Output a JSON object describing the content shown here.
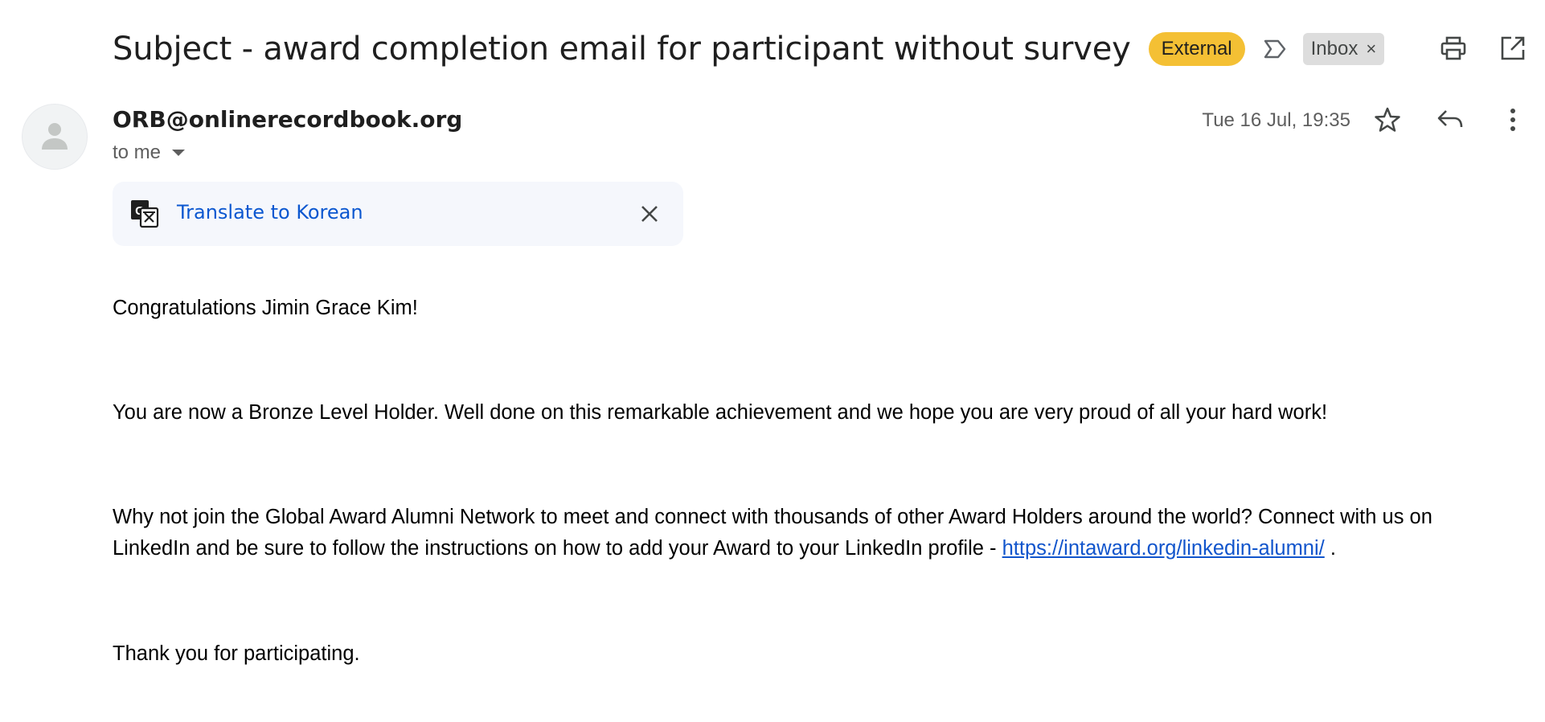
{
  "header": {
    "subject": "Subject - award completion email for participant without survey",
    "external_label": "External",
    "inbox_label": "Inbox",
    "inbox_remove": "×"
  },
  "message": {
    "sender": "ORB@onlinerecordbook.org",
    "recipient": "to me",
    "date": "Tue 16 Jul, 19:35"
  },
  "translate": {
    "link_label": "Translate to Korean"
  },
  "body": {
    "greeting": "Congratulations Jimin Grace Kim!",
    "paragraph1": "You are now a Bronze Level Holder. Well done on this remarkable achievement and we hope you are very proud of all your hard work!",
    "paragraph2_text": "Why not join the Global Award Alumni Network to meet and connect with thousands of other Award Holders around the world? Connect with us on LinkedIn and be sure to follow the instructions on how to add your Award to your LinkedIn profile - ",
    "paragraph2_link": "https://intaward.org/linkedin-alumni/",
    "paragraph2_end": " .",
    "closing": "Thank you for participating."
  },
  "colors": {
    "external_badge": "#f4c034",
    "inbox_badge": "#dddddd",
    "link_blue": "#0b57d0",
    "body_link": "#1155cc",
    "translate_bg": "#f5f7fc"
  },
  "icons": {
    "importance": "importance-marker-icon",
    "print": "print-icon",
    "open_new_window": "open-in-new-window-icon",
    "avatar": "person-icon",
    "star": "star-icon",
    "reply": "reply-icon",
    "more": "more-vertical-icon",
    "translate": "translate-icon",
    "close": "close-icon"
  }
}
